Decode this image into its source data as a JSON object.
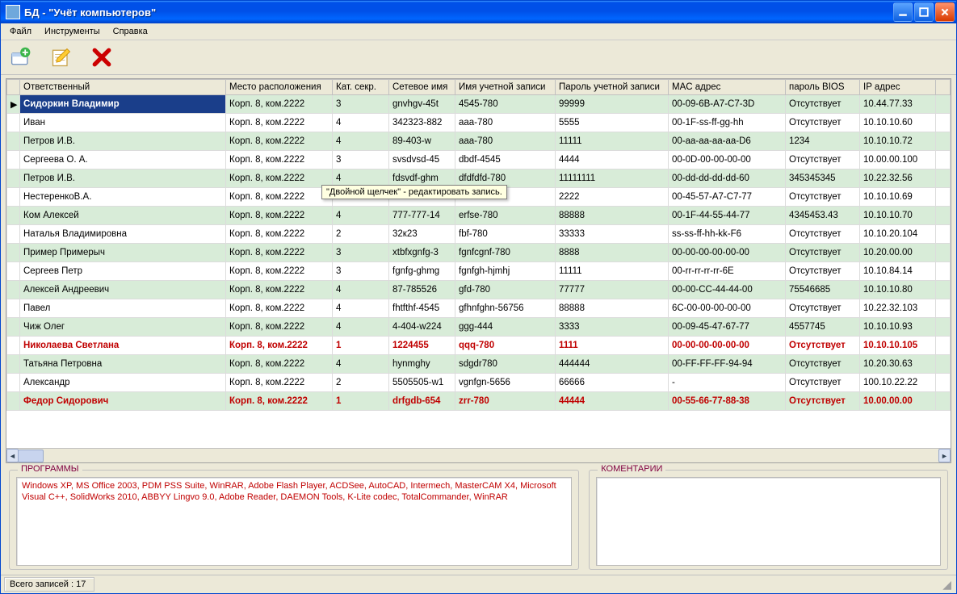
{
  "title": "БД -  \"Учёт компьютеров\"",
  "menu": {
    "file": "Файл",
    "tools": "Инструменты",
    "help": "Справка"
  },
  "tooltip": "\"Двойной щелчек\" - редактировать запись.",
  "columns": {
    "responsible": "Ответственный",
    "location": "Место расположения",
    "cat": "Кат. секр.",
    "netname": "Сетевое имя",
    "account": "Имя учетной записи",
    "password": "Пароль учетной записи",
    "mac": "MAC адрес",
    "bios": "пароль BIOS",
    "ip": "IP адрес"
  },
  "rows": [
    {
      "sel": true,
      "r": "Сидоркин Владимир",
      "loc": "Корп. 8, ком.2222",
      "cat": "3",
      "net": "gnvhgv-45t",
      "acc": "4545-780",
      "pwd": "99999",
      "mac": "00-09-6B-A7-C7-3D",
      "bios": "Отсутствует",
      "ip": "10.44.77.33"
    },
    {
      "r": "Иван",
      "loc": "Корп. 8, ком.2222",
      "cat": "4",
      "net": "342323-882",
      "acc": "aaa-780",
      "pwd": "5555",
      "mac": "00-1F-ss-ff-gg-hh",
      "bios": "Отсутствует",
      "ip": "10.10.10.60"
    },
    {
      "r": "Петров И.В.",
      "loc": "Корп. 8, ком.2222",
      "cat": "4",
      "net": "89-403-w",
      "acc": "aaa-780",
      "pwd": "11111",
      "mac": "00-aa-aa-aa-aa-D6",
      "bios": "1234",
      "ip": "10.10.10.72"
    },
    {
      "r": "Сергеева О. А.",
      "loc": "Корп. 8, ком.2222",
      "cat": "3",
      "net": "svsdvsd-45",
      "acc": "dbdf-4545",
      "pwd": "4444",
      "mac": "00-0D-00-00-00-00",
      "bios": "Отсутствует",
      "ip": "10.00.00.100"
    },
    {
      "r": "Петров И.В.",
      "loc": "Корп. 8, ком.2222",
      "cat": "4",
      "net": "fdsvdf-ghm",
      "acc": "dfdfdfd-780",
      "pwd": "11111111",
      "mac": "00-dd-dd-dd-dd-60",
      "bios": "345345345",
      "ip": "10.22.32.56"
    },
    {
      "r": "НестеренкоВ.А.",
      "loc": "Корп. 8, ком.2222",
      "cat": "",
      "net": "",
      "acc": "",
      "pwd": "2222",
      "mac": "00-45-57-A7-C7-77",
      "bios": "Отсутствует",
      "ip": "10.10.10.69"
    },
    {
      "r": "Ком Алексей",
      "loc": "Корп. 8, ком.2222",
      "cat": "4",
      "net": "777-777-14",
      "acc": "erfse-780",
      "pwd": "88888",
      "mac": "00-1F-44-55-44-77",
      "bios": "4345453.43",
      "ip": "10.10.10.70"
    },
    {
      "r": "Наталья Владимировна",
      "loc": "Корп. 8, ком.2222",
      "cat": "2",
      "net": "32к23",
      "acc": "fbf-780",
      "pwd": "33333",
      "mac": "ss-ss-ff-hh-kk-F6",
      "bios": "Отсутствует",
      "ip": "10.10.20.104"
    },
    {
      "r": "Пример Примерыч",
      "loc": "Корп. 8, ком.2222",
      "cat": "3",
      "net": "xtbfxgnfg-3",
      "acc": "fgnfcgnf-780",
      "pwd": "8888",
      "mac": "00-00-00-00-00-00",
      "bios": "Отсутствует",
      "ip": "10.20.00.00"
    },
    {
      "r": "Сергеев Петр",
      "loc": "Корп. 8, ком.2222",
      "cat": "3",
      "net": "fgnfg-ghmg",
      "acc": "fgnfgh-hjmhj",
      "pwd": "11111",
      "mac": "00-rr-rr-rr-rr-6E",
      "bios": "Отсутствует",
      "ip": "10.10.84.14"
    },
    {
      "r": "Алексей Андреевич",
      "loc": "Корп. 8, ком.2222",
      "cat": "4",
      "net": "87-785526",
      "acc": "gfd-780",
      "pwd": "77777",
      "mac": "00-00-CC-44-44-00",
      "bios": "75546685",
      "ip": "10.10.10.80"
    },
    {
      "r": "Павел",
      "loc": "Корп. 8, ком.2222",
      "cat": "4",
      "net": "fhtfthf-4545",
      "acc": "gfhnfghn-56756",
      "pwd": "88888",
      "mac": "6C-00-00-00-00-00",
      "bios": "Отсутствует",
      "ip": "10.22.32.103"
    },
    {
      "r": "Чиж Олег",
      "loc": "Корп. 8, ком.2222",
      "cat": "4",
      "net": "4-404-w224",
      "acc": "ggg-444",
      "pwd": "3333",
      "mac": "00-09-45-47-67-77",
      "bios": "4557745",
      "ip": "10.10.10.93"
    },
    {
      "red": true,
      "r": "Николаева Светлана",
      "loc": "Корп. 8, ком.2222",
      "cat": "1",
      "net": "1224455",
      "acc": "qqq-780",
      "pwd": "1111",
      "mac": "00-00-00-00-00-00",
      "bios": "Отсутствует",
      "ip": "10.10.10.105"
    },
    {
      "r": "Татьяна Петровна",
      "loc": "Корп. 8, ком.2222",
      "cat": "4",
      "net": "hynmghy",
      "acc": "sdgdr780",
      "pwd": "444444",
      "mac": "00-FF-FF-FF-94-94",
      "bios": "Отсутствует",
      "ip": "10.20.30.63"
    },
    {
      "r": "Александр",
      "loc": "Корп. 8, ком.2222",
      "cat": "2",
      "net": "5505505-w1",
      "acc": "vgnfgn-5656",
      "pwd": "66666",
      "mac": "-",
      "bios": "Отсутствует",
      "ip": "100.10.22.22"
    },
    {
      "red": true,
      "r": "Федор Сидорович",
      "loc": "Корп. 8, ком.2222",
      "cat": "1",
      "net": "drfgdb-654",
      "acc": "zrr-780",
      "pwd": "44444",
      "mac": "00-55-66-77-88-38",
      "bios": "Отсутствует",
      "ip": "10.00.00.00"
    }
  ],
  "panels": {
    "programs_title": "ПРОГРАММЫ",
    "programs_text": "Windows XP, MS Office 2003, PDM PSS Suite, WinRAR, Adobe Flash Player, ACDSee, AutoCAD, Intermech, MasterCAM X4, Microsoft Visual C++,  SolidWorks 2010, ABBYY Lingvo 9.0, Adobe Reader, DAEMON Tools, K-Lite codec, TotalCommander, WinRAR",
    "comments_title": "КОМЕНТАРИИ",
    "comments_text": ""
  },
  "status": "Всего записей : 17"
}
